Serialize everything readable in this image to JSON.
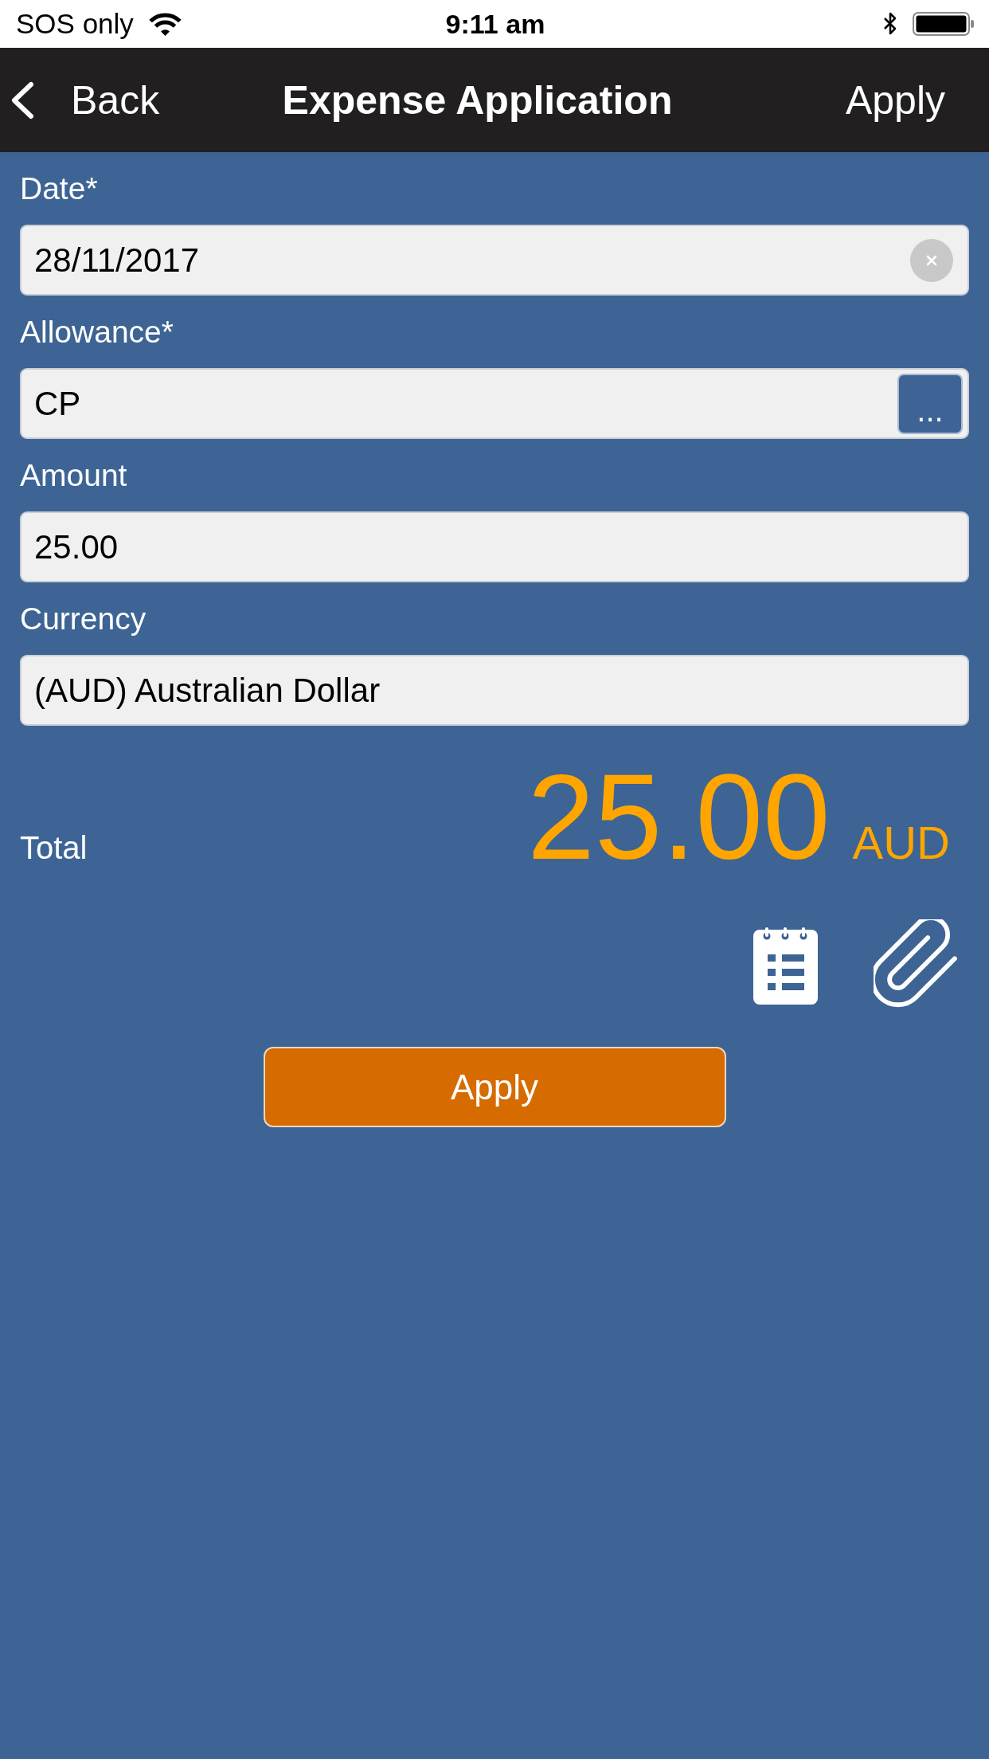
{
  "status_bar": {
    "carrier": "SOS only",
    "time": "9:11 am"
  },
  "nav_bar": {
    "back": "Back",
    "title": "Expense Application",
    "action": "Apply"
  },
  "fields": [
    {
      "label": "Date*",
      "value": "28/11/2017",
      "kind": "clearable"
    },
    {
      "label": "Allowance*",
      "value": "CP",
      "kind": "picker",
      "button": "..."
    },
    {
      "label": "Amount",
      "value": "25.00",
      "kind": "plain"
    },
    {
      "label": "Currency",
      "value": "(AUD) Australian Dollar",
      "kind": "plain"
    }
  ],
  "total": {
    "label": "Total",
    "amount": "25.00",
    "currency": "AUD"
  },
  "apply_button": "Apply"
}
